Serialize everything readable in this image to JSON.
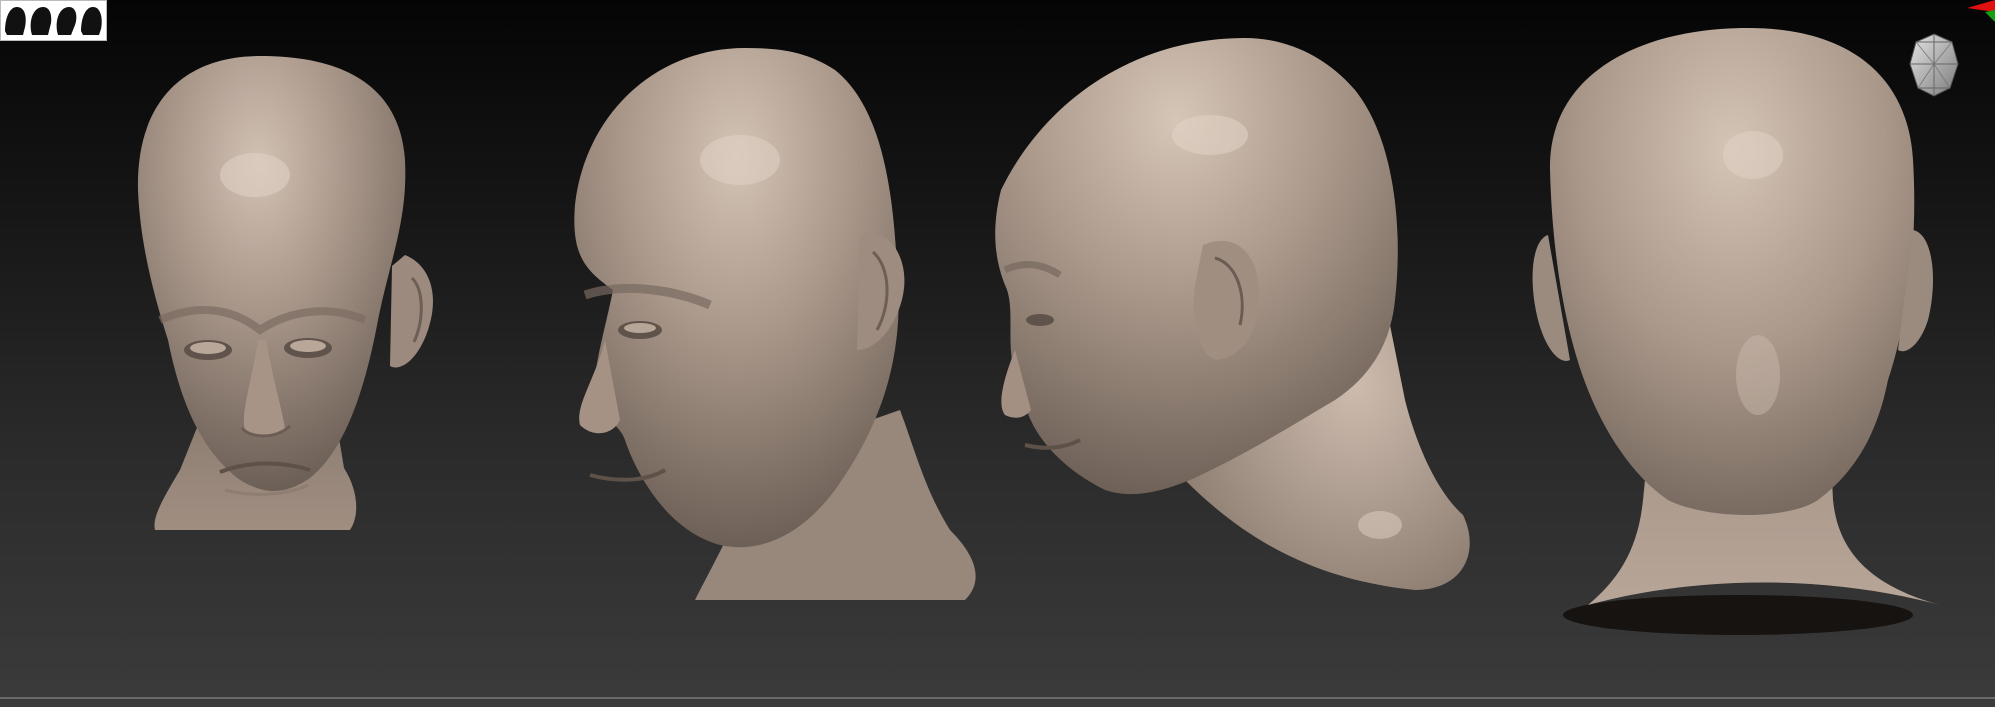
{
  "app": {
    "title": ""
  },
  "viewport": {
    "background_top": "#050505",
    "background_bottom": "#3b3b3b"
  },
  "material": {
    "clay_color": "#a8968a",
    "shadow_color": "#6e6158",
    "highlight_color": "#d7c7ba"
  },
  "views": [
    {
      "name": "front"
    },
    {
      "name": "three-quarter"
    },
    {
      "name": "side"
    },
    {
      "name": "back"
    }
  ],
  "icons": {
    "thumbnail": "head-thumbnails-icon",
    "axis": "axis-gizmo-icon",
    "navigation": "navigation-cube-icon"
  }
}
